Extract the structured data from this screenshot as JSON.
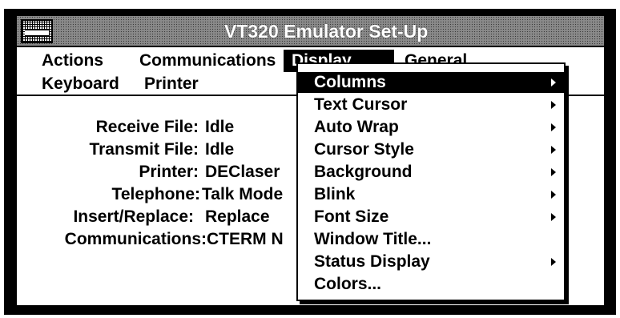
{
  "window": {
    "title": "VT320 Emulator Set-Up"
  },
  "menubar": {
    "row1": [
      {
        "label": "Actions",
        "selected": false
      },
      {
        "label": "Communications",
        "selected": false
      },
      {
        "label": "Display",
        "selected": true
      },
      {
        "label": "General",
        "selected": false
      }
    ],
    "row2": [
      {
        "label": "Keyboard",
        "selected": false
      },
      {
        "label": "Printer",
        "selected": false
      }
    ]
  },
  "status": [
    {
      "label": "Receive File:",
      "value": "Idle"
    },
    {
      "label": "Transmit File:",
      "value": "Idle"
    },
    {
      "label": "Printer:",
      "value": "DEClaser"
    },
    {
      "label": "Telephone:",
      "value": "Talk Mode"
    },
    {
      "label": "Insert/Replace:",
      "value": "Replace"
    },
    {
      "label": "Communications:",
      "value": "CTERM N"
    }
  ],
  "display_menu": {
    "items": [
      {
        "label": "Columns",
        "submenu": true,
        "highlighted": true
      },
      {
        "label": "Text Cursor",
        "submenu": true,
        "highlighted": false
      },
      {
        "label": "Auto Wrap",
        "submenu": true,
        "highlighted": false
      },
      {
        "label": "Cursor Style",
        "submenu": true,
        "highlighted": false
      },
      {
        "label": "Background",
        "submenu": true,
        "highlighted": false
      },
      {
        "label": "Blink",
        "submenu": true,
        "highlighted": false
      },
      {
        "label": "Font Size",
        "submenu": true,
        "highlighted": false
      },
      {
        "label": "Window Title...",
        "submenu": false,
        "highlighted": false
      },
      {
        "label": "Status Display",
        "submenu": true,
        "highlighted": false
      },
      {
        "label": "Colors...",
        "submenu": false,
        "highlighted": false
      }
    ]
  },
  "icons": {
    "system_menu": "system-menu-icon",
    "submenu_arrow": "submenu-arrow-icon"
  },
  "colors": {
    "highlight_bg": "#000000",
    "highlight_fg": "#ffffff"
  }
}
